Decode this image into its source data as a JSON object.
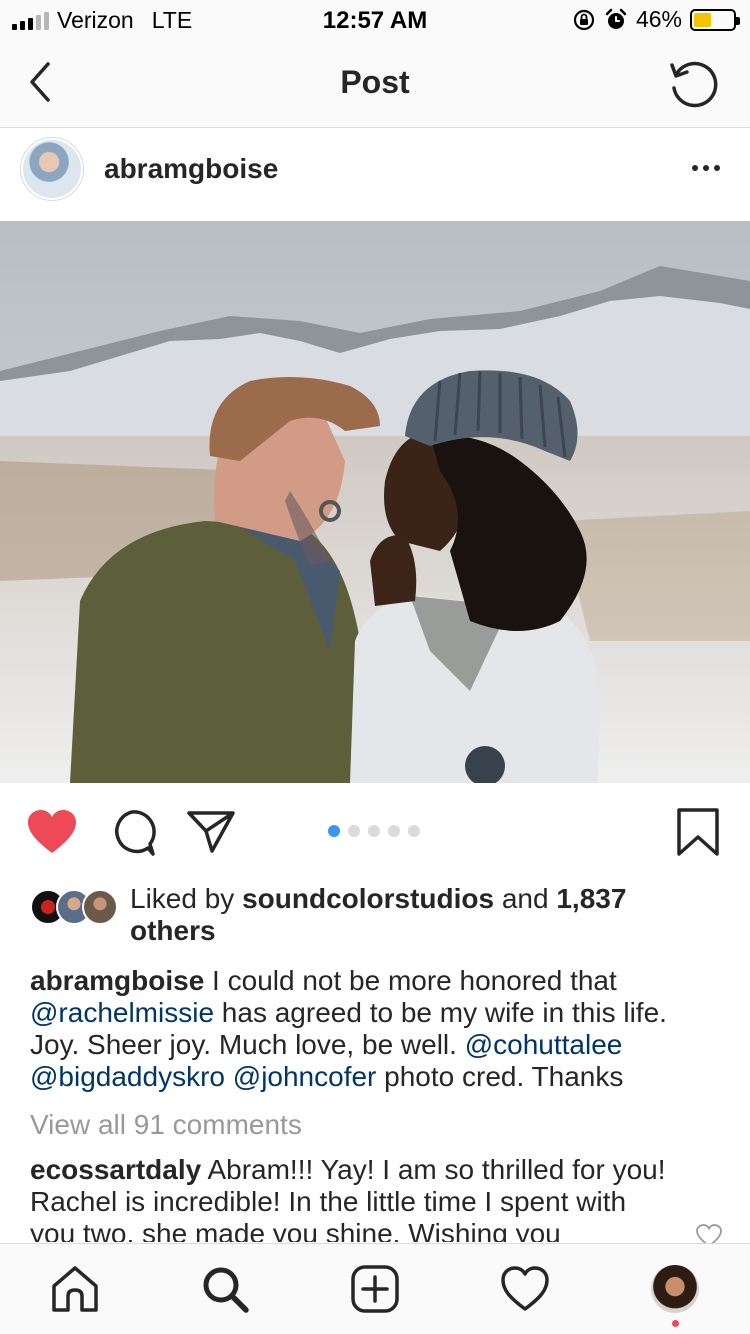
{
  "status_bar": {
    "carrier": "Verizon",
    "network": "LTE",
    "time": "12:57 AM",
    "battery_percent": "46%",
    "battery_level": 0.46,
    "battery_color": "#f5c400"
  },
  "nav": {
    "title": "Post",
    "back_icon": "chevron-left-icon",
    "refresh_icon": "refresh-icon"
  },
  "post": {
    "username": "abramgboise",
    "more_icon": "ellipsis-icon",
    "photo_alt": "",
    "carousel": {
      "total": 5,
      "active_index": 0
    },
    "liked": true,
    "like_color": "#ed4956",
    "accent_color": "#3897f0",
    "likes": {
      "prefix": "Liked by ",
      "user": "soundcolorstudios",
      "and": " and ",
      "count": "1,837",
      "suffix": "others"
    },
    "caption": {
      "username": "abramgboise",
      "parts": [
        " I could not be more honored that ",
        "@rachelmissie",
        " has agreed to be my wife in this life. Joy. Sheer joy. Much love, be well. ",
        "@cohuttalee",
        " ",
        "@bigdaddyskro",
        " ",
        "@johncofer",
        " photo cred. Thanks"
      ],
      "mention_color": "#003569"
    },
    "view_all_comments": "View all 91 comments",
    "comment": {
      "username": "ecossartdaly",
      "text": " Abram!!! Yay! I am so thrilled for you! Rachel is incredible! In the little time I spent with you two, she made you shine. Wishing you"
    }
  },
  "tabbar": {
    "items": [
      "home-icon",
      "search-icon",
      "new-post-icon",
      "activity-icon",
      "profile-avatar"
    ],
    "notification_dot_color": "#ed4956"
  }
}
